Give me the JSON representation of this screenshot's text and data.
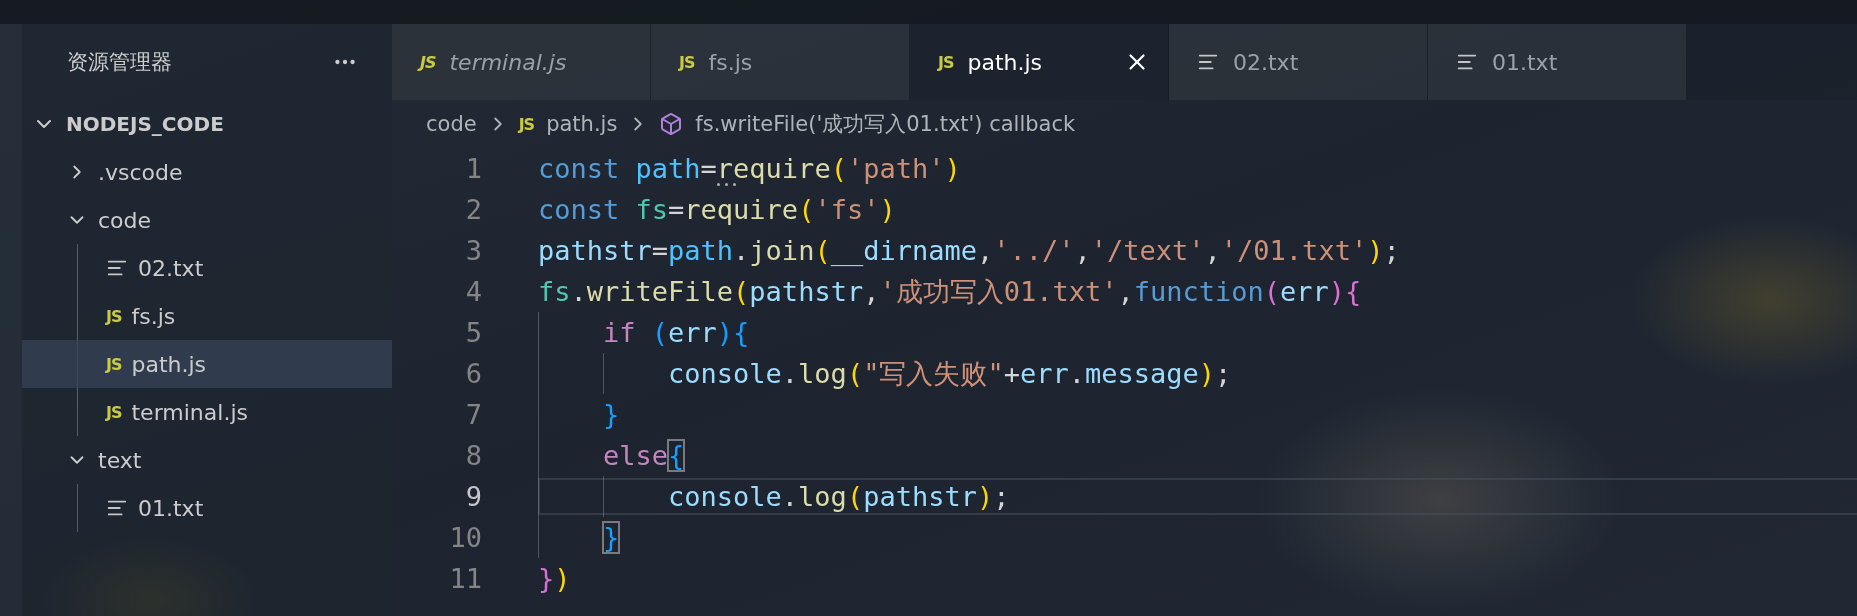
{
  "sidebar": {
    "title": "资源管理器",
    "workspace": {
      "name": "NODEJS_CODE",
      "expanded": true,
      "children": [
        {
          "name": ".vscode",
          "kind": "folder",
          "expanded": false,
          "selected": false
        },
        {
          "name": "code",
          "kind": "folder",
          "expanded": true,
          "selected": false,
          "children": [
            {
              "name": "02.txt",
              "kind": "txt",
              "selected": false
            },
            {
              "name": "fs.js",
              "kind": "js",
              "badge": "JS",
              "selected": false
            },
            {
              "name": "path.js",
              "kind": "js",
              "badge": "JS",
              "selected": true
            },
            {
              "name": "terminal.js",
              "kind": "js",
              "badge": "JS",
              "selected": false
            }
          ]
        },
        {
          "name": "text",
          "kind": "folder",
          "expanded": true,
          "selected": false,
          "children": [
            {
              "name": "01.txt",
              "kind": "txt",
              "selected": false
            }
          ]
        }
      ]
    }
  },
  "tabs": [
    {
      "label": "terminal.js",
      "kind": "js",
      "badge": "JS",
      "preview": true,
      "selected": false
    },
    {
      "label": "fs.js",
      "kind": "js",
      "badge": "JS",
      "preview": false,
      "selected": false
    },
    {
      "label": "path.js",
      "kind": "js",
      "badge": "JS",
      "preview": false,
      "selected": true
    },
    {
      "label": "02.txt",
      "kind": "txt",
      "preview": false,
      "selected": false
    },
    {
      "label": "01.txt",
      "kind": "txt",
      "preview": false,
      "selected": false
    }
  ],
  "breadcrumb": [
    {
      "kind": "folder",
      "label": "code"
    },
    {
      "kind": "js",
      "badge": "JS",
      "label": "path.js"
    },
    {
      "kind": "method",
      "label": "fs.writeFile('成功写入01.txt') callback"
    }
  ],
  "code": {
    "lines": [
      {
        "number": "1",
        "current": false,
        "tokens": [
          {
            "kind": "kw",
            "text": "const "
          },
          {
            "kind": "const",
            "text": "path"
          },
          {
            "kind": "punc",
            "text": "="
          },
          {
            "kind": "fn",
            "text": "require",
            "hint": true
          },
          {
            "kind": "b1",
            "text": "("
          },
          {
            "kind": "str",
            "text": "'path'"
          },
          {
            "kind": "b1",
            "text": ")"
          }
        ]
      },
      {
        "number": "2",
        "current": false,
        "tokens": [
          {
            "kind": "kw",
            "text": "const "
          },
          {
            "kind": "type",
            "text": "fs"
          },
          {
            "kind": "punc",
            "text": "="
          },
          {
            "kind": "fn",
            "text": "require"
          },
          {
            "kind": "b1",
            "text": "("
          },
          {
            "kind": "str",
            "text": "'fs'"
          },
          {
            "kind": "b1",
            "text": ")"
          }
        ]
      },
      {
        "number": "3",
        "current": false,
        "tokens": [
          {
            "kind": "var",
            "text": "pathstr"
          },
          {
            "kind": "punc",
            "text": "="
          },
          {
            "kind": "const",
            "text": "path"
          },
          {
            "kind": "punc",
            "text": "."
          },
          {
            "kind": "fn",
            "text": "join"
          },
          {
            "kind": "b1",
            "text": "("
          },
          {
            "kind": "var",
            "text": "__dirname"
          },
          {
            "kind": "punc",
            "text": ","
          },
          {
            "kind": "str",
            "text": "'../'"
          },
          {
            "kind": "punc",
            "text": ","
          },
          {
            "kind": "str",
            "text": "'/text'"
          },
          {
            "kind": "punc",
            "text": ","
          },
          {
            "kind": "str",
            "text": "'/01.txt'"
          },
          {
            "kind": "b1",
            "text": ")"
          },
          {
            "kind": "punc",
            "text": ";"
          }
        ]
      },
      {
        "number": "4",
        "current": false,
        "tokens": [
          {
            "kind": "type",
            "text": "fs"
          },
          {
            "kind": "punc",
            "text": "."
          },
          {
            "kind": "fn",
            "text": "writeFile"
          },
          {
            "kind": "b1",
            "text": "("
          },
          {
            "kind": "var",
            "text": "pathstr"
          },
          {
            "kind": "punc",
            "text": ","
          },
          {
            "kind": "str",
            "text": "'成功写入01.txt'"
          },
          {
            "kind": "punc",
            "text": ","
          },
          {
            "kind": "kw",
            "text": "function"
          },
          {
            "kind": "b2",
            "text": "("
          },
          {
            "kind": "var",
            "text": "err"
          },
          {
            "kind": "b2",
            "text": ")"
          },
          {
            "kind": "b2",
            "text": "{"
          }
        ]
      },
      {
        "number": "5",
        "current": false,
        "tokens": [
          {
            "kind": "ctrl",
            "text": "    if "
          },
          {
            "kind": "b3",
            "text": "("
          },
          {
            "kind": "var",
            "text": "err"
          },
          {
            "kind": "b3",
            "text": ")"
          },
          {
            "kind": "b3",
            "text": "{"
          }
        ]
      },
      {
        "number": "6",
        "current": false,
        "tokens": [
          {
            "kind": "var",
            "text": "        console"
          },
          {
            "kind": "punc",
            "text": "."
          },
          {
            "kind": "fn",
            "text": "log"
          },
          {
            "kind": "b1",
            "text": "("
          },
          {
            "kind": "str",
            "text": "\"写入失败\""
          },
          {
            "kind": "punc",
            "text": "+"
          },
          {
            "kind": "var",
            "text": "err"
          },
          {
            "kind": "punc",
            "text": "."
          },
          {
            "kind": "var",
            "text": "message"
          },
          {
            "kind": "b1",
            "text": ")"
          },
          {
            "kind": "punc",
            "text": ";"
          }
        ]
      },
      {
        "number": "7",
        "current": false,
        "tokens": [
          {
            "kind": "b3",
            "text": "    }"
          }
        ]
      },
      {
        "number": "8",
        "current": false,
        "tokens": [
          {
            "kind": "ctrl",
            "text": "    else"
          },
          {
            "kind": "b3",
            "text": "{",
            "matched": true
          }
        ]
      },
      {
        "number": "9",
        "current": true,
        "tokens": [
          {
            "kind": "var",
            "text": "        console"
          },
          {
            "kind": "punc",
            "text": "."
          },
          {
            "kind": "fn",
            "text": "log"
          },
          {
            "kind": "b1",
            "text": "("
          },
          {
            "kind": "var",
            "text": "pathstr"
          },
          {
            "kind": "b1",
            "text": ")"
          },
          {
            "kind": "punc",
            "text": ";"
          }
        ]
      },
      {
        "number": "10",
        "current": false,
        "tokens": [
          {
            "kind": "b3",
            "text": "    }",
            "matched": true
          }
        ]
      },
      {
        "number": "11",
        "current": false,
        "tokens": [
          {
            "kind": "b2",
            "text": "}"
          },
          {
            "kind": "b1",
            "text": ")"
          }
        ]
      }
    ]
  }
}
